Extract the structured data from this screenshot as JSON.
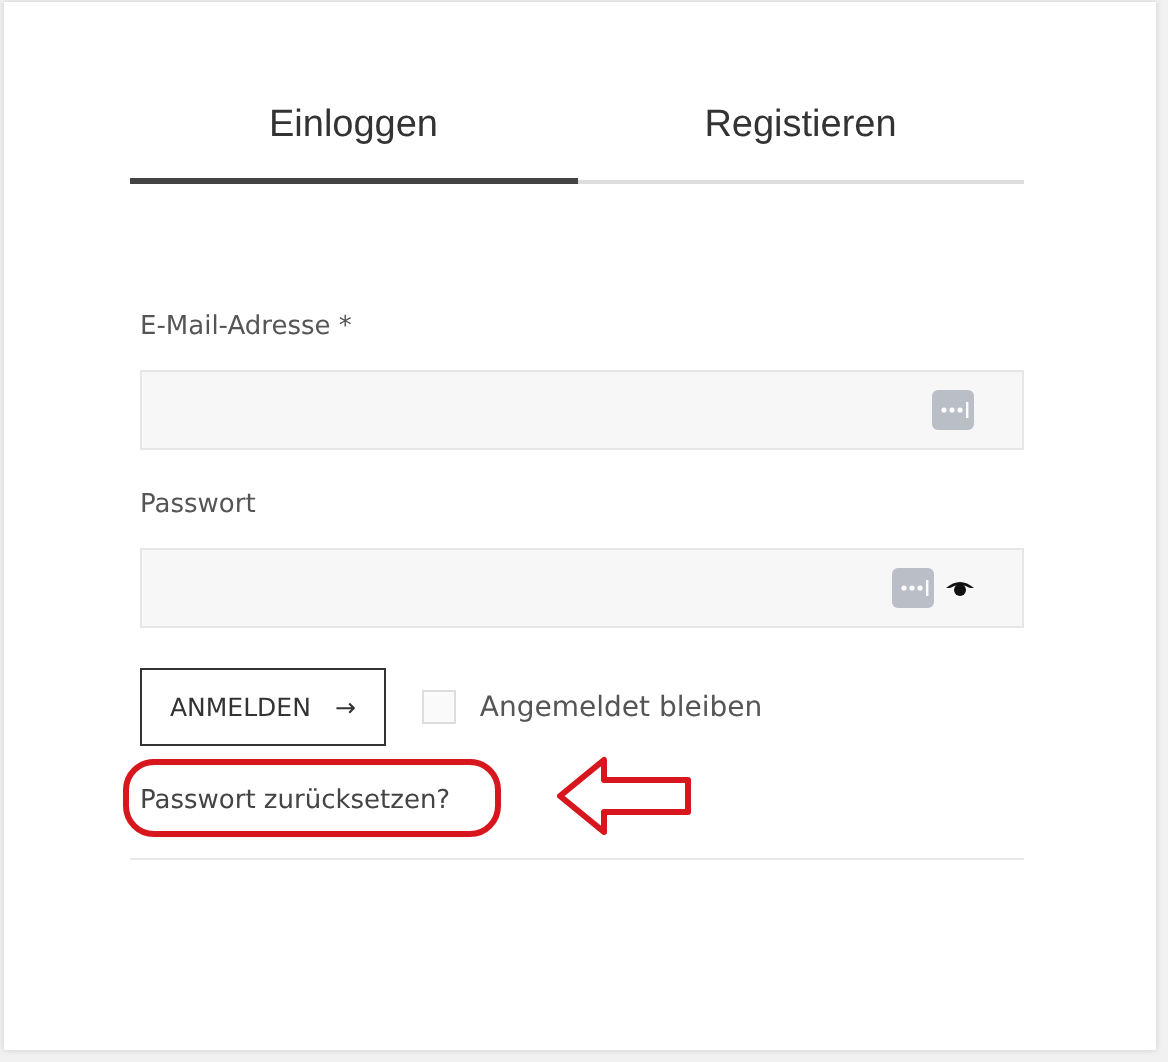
{
  "tabs": [
    {
      "label": "Einloggen",
      "selected": true
    },
    {
      "label": "Registieren",
      "selected": false
    }
  ],
  "fields": [
    {
      "label": "E-Mail-Adresse *",
      "kind": "text"
    },
    {
      "label": "Passwort",
      "kind": "password"
    }
  ],
  "submit": {
    "label": "ANMELDEN",
    "arrow": "→"
  },
  "remember": {
    "label": "Angemeldet bleiben",
    "checked": false
  },
  "reset_link": {
    "label": "Passwort zurücksetzen?",
    "highlighted": true
  }
}
